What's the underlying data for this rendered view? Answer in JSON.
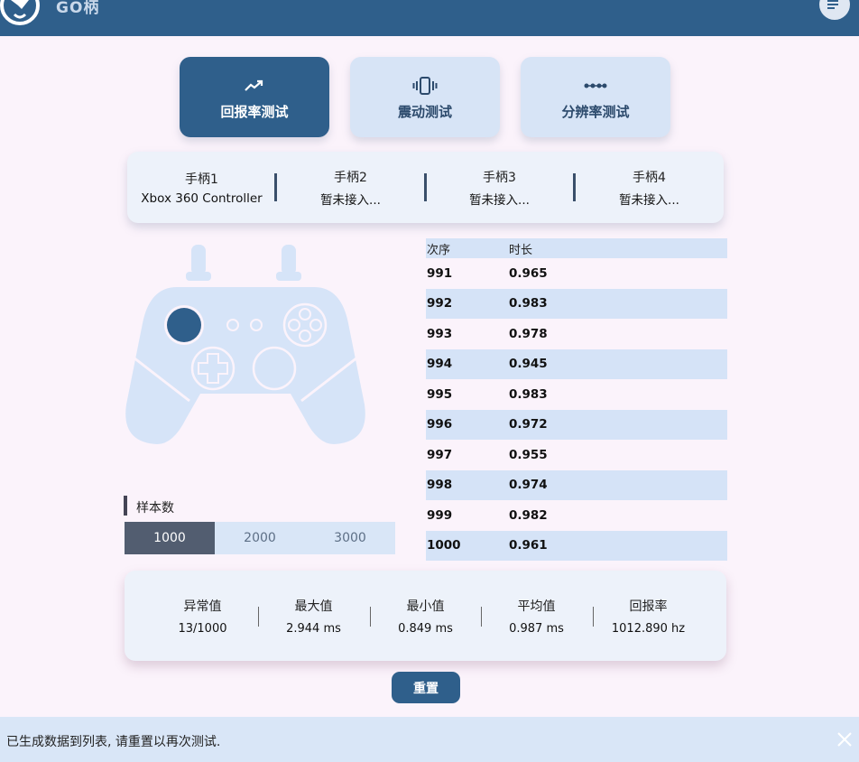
{
  "app": {
    "title": "GO柄"
  },
  "mode_tabs": [
    {
      "label": "回报率测试",
      "icon": "trend-up-icon",
      "active": true
    },
    {
      "label": "震动测试",
      "icon": "vibrate-icon",
      "active": false
    },
    {
      "label": "分辨率测试",
      "icon": "dots-line-icon",
      "active": false
    }
  ],
  "controllers": [
    {
      "name": "手柄1",
      "status": "Xbox 360 Controller"
    },
    {
      "name": "手柄2",
      "status": "暂未接入..."
    },
    {
      "name": "手柄3",
      "status": "暂未接入..."
    },
    {
      "name": "手柄4",
      "status": "暂未接入..."
    }
  ],
  "samples": {
    "title": "样本数",
    "options": [
      "1000",
      "2000",
      "3000"
    ],
    "selected": "1000"
  },
  "table": {
    "headers": [
      "次序",
      "时长"
    ],
    "rows": [
      [
        "991",
        "0.965"
      ],
      [
        "992",
        "0.983"
      ],
      [
        "993",
        "0.978"
      ],
      [
        "994",
        "0.945"
      ],
      [
        "995",
        "0.983"
      ],
      [
        "996",
        "0.972"
      ],
      [
        "997",
        "0.955"
      ],
      [
        "998",
        "0.974"
      ],
      [
        "999",
        "0.982"
      ],
      [
        "1000",
        "0.961"
      ]
    ]
  },
  "stats": [
    {
      "label": "异常值",
      "value": "13/1000"
    },
    {
      "label": "最大值",
      "value": "2.944 ms"
    },
    {
      "label": "最小值",
      "value": "0.849 ms"
    },
    {
      "label": "平均值",
      "value": "0.987 ms"
    },
    {
      "label": "回报率",
      "value": "1012.890 hz"
    }
  ],
  "reset_label": "重置",
  "status_message": "已生成数据到列表, 请重置以再次测试.",
  "colors": {
    "primary": "#2f5f8b",
    "light_blue": "#d7e4f6",
    "page_bg": "#fbf3fb",
    "selected_segment": "#525d70"
  }
}
